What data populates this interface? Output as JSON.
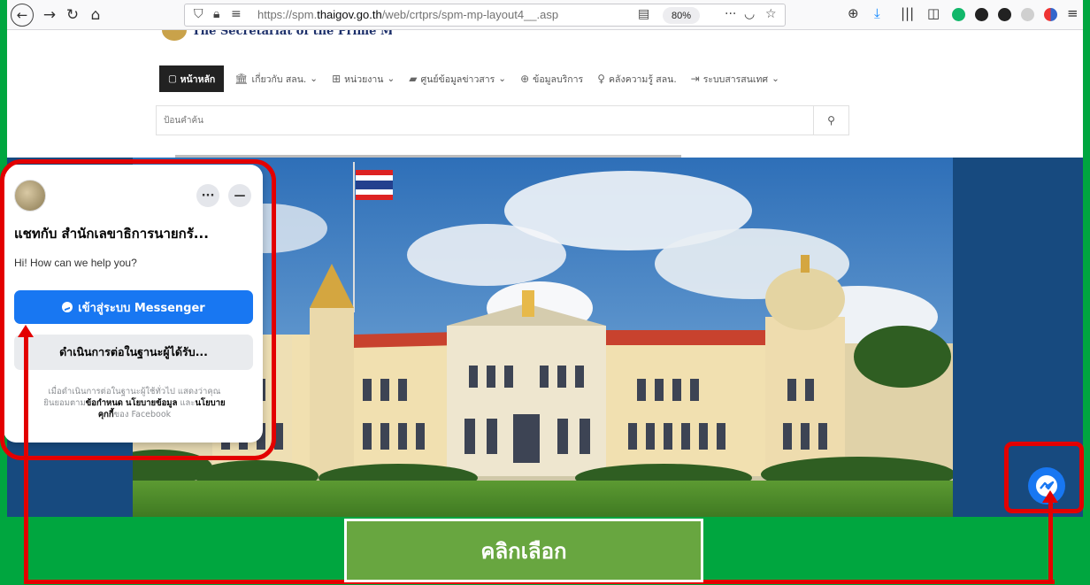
{
  "browser": {
    "url_prefix": "https://spm.",
    "url_domain": "thaigov.go.th",
    "url_path": "/web/crtprs/spm-mp-layout4__.asp",
    "zoom": "80%"
  },
  "site": {
    "logo_text": "The Secretariat of the Prime Minister",
    "menu": {
      "home": "หน้าหลัก",
      "items": [
        {
          "label": "เกี่ยวกับ สลน.",
          "icon": "bank-icon",
          "has_dropdown": true
        },
        {
          "label": "หน่วยงาน",
          "icon": "org-chart-icon",
          "has_dropdown": true
        },
        {
          "label": "ศูนย์ข้อมูลข่าวสาร",
          "icon": "book-icon",
          "has_dropdown": true
        },
        {
          "label": "ข้อมูลบริการ",
          "icon": "globe-icon",
          "has_dropdown": false
        },
        {
          "label": "คลังความรู้ สลน.",
          "icon": "lightbulb-icon",
          "has_dropdown": false
        },
        {
          "label": "ระบบสารสนเทศ",
          "icon": "login-icon",
          "has_dropdown": true
        }
      ]
    },
    "search": {
      "placeholder": "ป้อนคำค้น"
    }
  },
  "chat": {
    "title": "แชทกับ สำนักเลขาธิการนายกรั...",
    "subtitle": "Hi! How can we help you?",
    "login_button": "เข้าสู่ระบบ Messenger",
    "guest_button": "ดำเนินการต่อในฐานะผู้ได้รับ...",
    "legal": {
      "line1": "เมื่อดำเนินการต่อในฐานะผู้ใช้ทั่วไป แสดงว่าคุณ",
      "line2_pre": "ยินยอมตาม",
      "terms": "ข้อกำหนด",
      "privacy": "นโยบายข้อมูล",
      "and": "และ",
      "cookies_a": "นโยบาย",
      "cookies_b": "คุกกี้",
      "of_facebook": "ของ Facebook"
    }
  },
  "overlay": {
    "cta_label": "คลิกเลือก"
  },
  "colors": {
    "frame_green": "#00a63f",
    "annotation_red": "#e30000",
    "messenger_blue": "#1877f2",
    "cta_green": "#68a640"
  }
}
